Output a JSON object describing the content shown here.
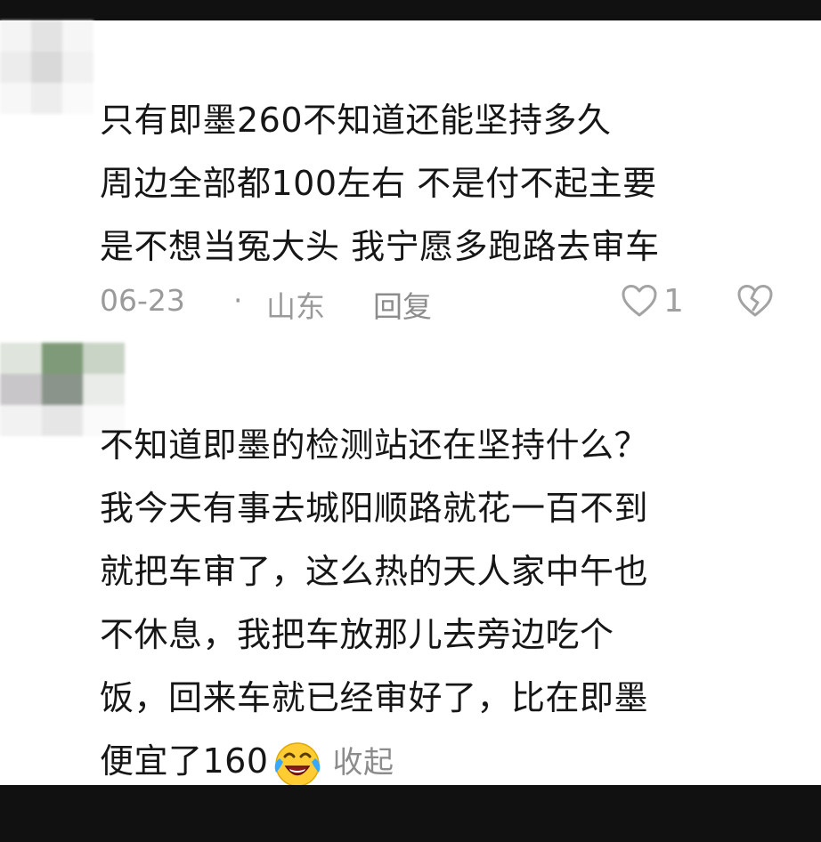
{
  "comments": [
    {
      "lines": [
        "只有即墨260不知道还能坚持多久",
        "周边全部都100左右  不是付不起主要",
        "是不想当冤大头  我宁愿多跑路去审车"
      ],
      "date": "06-23",
      "separator": "·",
      "location": "山东",
      "reply_label": "回复",
      "like_count": "1",
      "icons": [
        "heart-outline-icon",
        "broken-heart-icon"
      ]
    },
    {
      "lines": [
        "不知道即墨的检测站还在坚持什么？",
        "我今天有事去城阳顺路就花一百不到",
        "就把车审了，这么热的天人家中午也",
        "不休息，我把车放那儿去旁边吃个",
        "饭，回来车就已经审好了，比在即墨"
      ],
      "last_line_text": "便宜了160",
      "emoji": "laughing-crying-emoji-icon",
      "collapse_label": "收起"
    }
  ],
  "colors": {
    "text": "#161616",
    "meta": "#9a9a9a",
    "bars": "#111111"
  }
}
